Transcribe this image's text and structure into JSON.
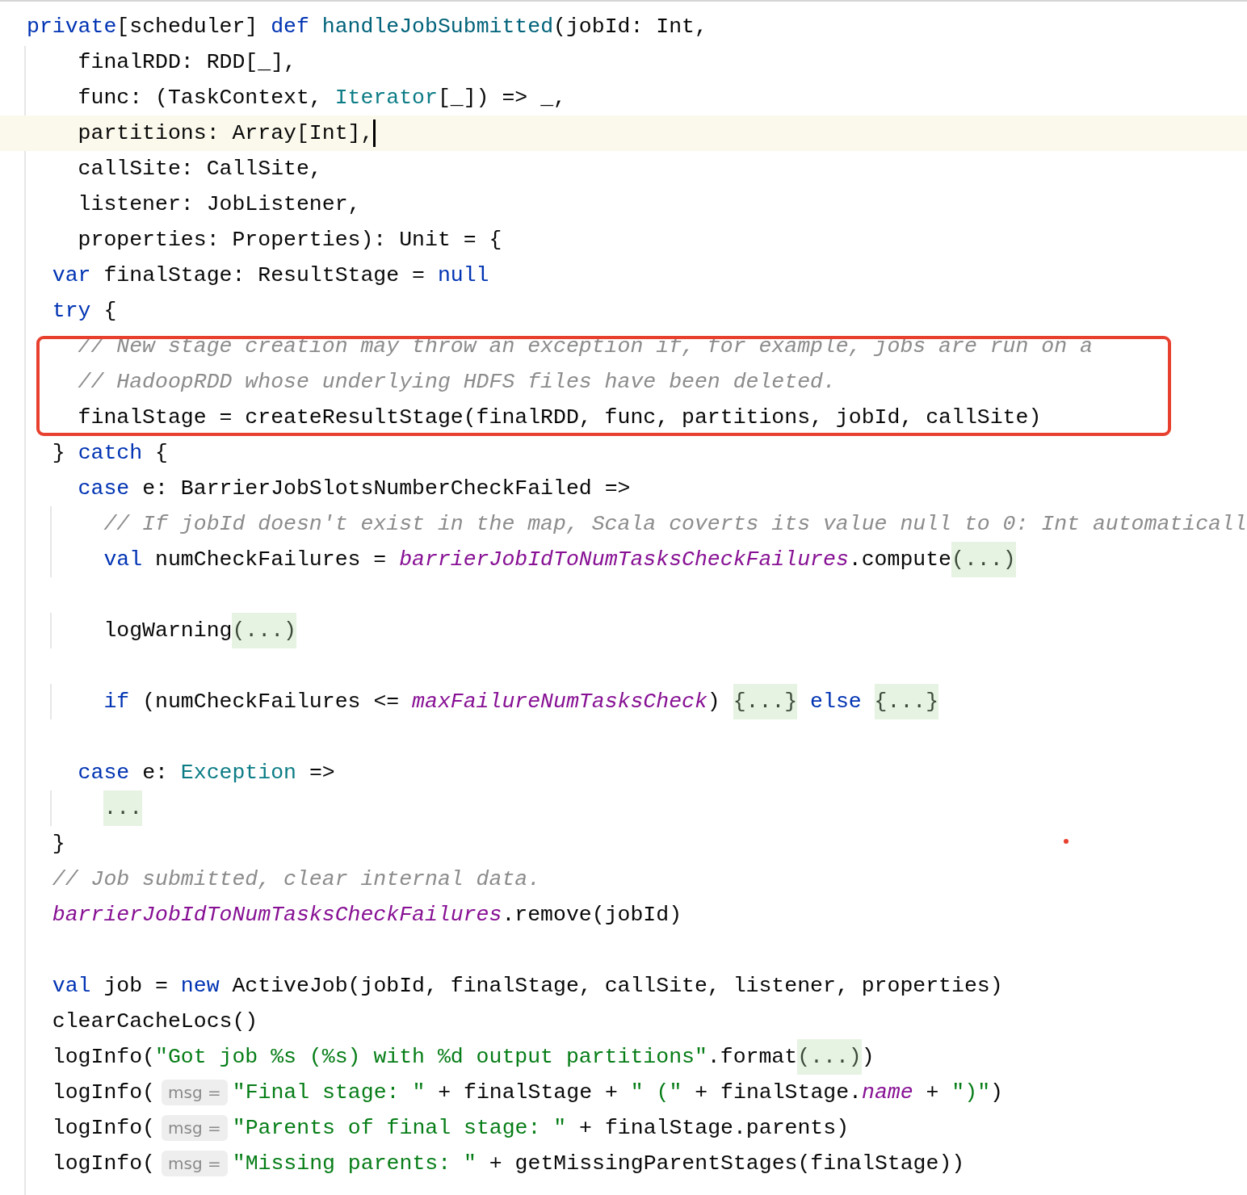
{
  "editor": {
    "blocks": [
      {
        "annotated": false,
        "lines": [
          {
            "current": false,
            "tokens": [
              {
                "kind": "kw",
                "text": "private"
              },
              {
                "kind": "plain",
                "text": "[scheduler] "
              },
              {
                "kind": "kw",
                "text": "def "
              },
              {
                "kind": "fn",
                "text": "handleJobSubmitted"
              },
              {
                "kind": "plain",
                "text": "(jobId: Int,"
              }
            ]
          },
          {
            "current": false,
            "tokens": [
              {
                "kind": "plain",
                "text": "    finalRDD: RDD[_],"
              }
            ]
          },
          {
            "current": false,
            "tokens": [
              {
                "kind": "plain",
                "text": "    func: (TaskContext, "
              },
              {
                "kind": "type",
                "text": "Iterator"
              },
              {
                "kind": "plain",
                "text": "[_]) => _,"
              }
            ]
          },
          {
            "current": true,
            "tokens": [
              {
                "kind": "plain",
                "text": "    partitions: Array[Int],"
              }
            ]
          },
          {
            "current": false,
            "tokens": [
              {
                "kind": "plain",
                "text": "    callSite: CallSite,"
              }
            ]
          },
          {
            "current": false,
            "tokens": [
              {
                "kind": "plain",
                "text": "    listener: JobListener,"
              }
            ]
          },
          {
            "current": false,
            "tokens": [
              {
                "kind": "plain",
                "text": "    properties: Properties): Unit = {"
              }
            ]
          },
          {
            "current": false,
            "tokens": [
              {
                "kind": "kw",
                "text": "  var"
              },
              {
                "kind": "plain",
                "text": " finalStage: ResultStage = "
              },
              {
                "kind": "kw",
                "text": "null"
              }
            ]
          },
          {
            "current": false,
            "tokens": [
              {
                "kind": "kw",
                "text": "  try"
              },
              {
                "kind": "plain",
                "text": " {"
              }
            ]
          }
        ]
      },
      {
        "annotated": true,
        "lines": [
          {
            "current": false,
            "tokens": [
              {
                "kind": "comment",
                "text": "    // New stage creation may throw an exception if, for example, jobs are run on a"
              }
            ]
          },
          {
            "current": false,
            "tokens": [
              {
                "kind": "comment",
                "text": "    // HadoopRDD whose underlying HDFS files have been deleted."
              }
            ]
          },
          {
            "current": false,
            "tokens": [
              {
                "kind": "plain",
                "text": "    finalStage = createResultStage(finalRDD, func, partitions, jobId, callSite)"
              }
            ]
          }
        ]
      },
      {
        "annotated": false,
        "lines": [
          {
            "current": false,
            "tokens": [
              {
                "kind": "plain",
                "text": "  } "
              },
              {
                "kind": "kw",
                "text": "catch"
              },
              {
                "kind": "plain",
                "text": " {"
              }
            ]
          },
          {
            "current": false,
            "tokens": [
              {
                "kind": "kw",
                "text": "    case"
              },
              {
                "kind": "plain",
                "text": " e: BarrierJobSlotsNumberCheckFailed =>"
              }
            ]
          },
          {
            "current": false,
            "tokens": [
              {
                "kind": "comment",
                "text": "      // If jobId doesn't exist in the map, Scala coverts its value null to 0: Int automaticall"
              }
            ]
          },
          {
            "current": false,
            "tokens": [
              {
                "kind": "kw",
                "text": "      val"
              },
              {
                "kind": "plain",
                "text": " numCheckFailures = "
              },
              {
                "kind": "field",
                "text": "barrierJobIdToNumTasksCheckFailures"
              },
              {
                "kind": "plain",
                "text": ".compute"
              },
              {
                "kind": "fold",
                "text": "(...)"
              }
            ]
          },
          {
            "current": false
          },
          {
            "current": false,
            "tokens": [
              {
                "kind": "plain",
                "text": "      logWarning"
              },
              {
                "kind": "fold",
                "text": "(...)"
              }
            ]
          },
          {
            "current": false
          },
          {
            "current": false,
            "tokens": [
              {
                "kind": "kw",
                "text": "      if"
              },
              {
                "kind": "plain",
                "text": " (numCheckFailures <= "
              },
              {
                "kind": "field",
                "text": "maxFailureNumTasksCheck"
              },
              {
                "kind": "plain",
                "text": ") "
              },
              {
                "kind": "fold",
                "text": "{...}"
              },
              {
                "kind": "kw",
                "text": " else "
              },
              {
                "kind": "fold",
                "text": "{...}"
              }
            ]
          },
          {
            "current": false
          },
          {
            "current": false,
            "tokens": [
              {
                "kind": "kw",
                "text": "    case"
              },
              {
                "kind": "plain",
                "text": " e: "
              },
              {
                "kind": "type",
                "text": "Exception"
              },
              {
                "kind": "plain",
                "text": " =>"
              }
            ]
          },
          {
            "current": false,
            "tokens": [
              {
                "kind": "fold",
                "text": "      ..."
              }
            ]
          },
          {
            "current": false,
            "tokens": [
              {
                "kind": "plain",
                "text": "  }"
              }
            ]
          },
          {
            "current": false,
            "tokens": [
              {
                "kind": "comment",
                "text": "  // Job submitted, clear internal data."
              }
            ]
          },
          {
            "current": false,
            "tokens": [
              {
                "kind": "field",
                "text": "  barrierJobIdToNumTasksCheckFailures"
              },
              {
                "kind": "plain",
                "text": ".remove(jobId)"
              }
            ]
          },
          {
            "current": false
          },
          {
            "current": false,
            "tokens": [
              {
                "kind": "kw",
                "text": "  val"
              },
              {
                "kind": "plain",
                "text": " job = "
              },
              {
                "kind": "kw",
                "text": "new"
              },
              {
                "kind": "plain",
                "text": " ActiveJob(jobId, finalStage, callSite, listener, properties)"
              }
            ]
          },
          {
            "current": false,
            "tokens": [
              {
                "kind": "plain",
                "text": "  clearCacheLocs()"
              }
            ]
          },
          {
            "current": false,
            "tokens": [
              {
                "kind": "plain",
                "text": "  logInfo("
              },
              {
                "kind": "string",
                "text": "\"Got job %s (%s) with %d output partitions\""
              },
              {
                "kind": "plain",
                "text": ".format"
              },
              {
                "kind": "fold",
                "text": "(...)"
              },
              {
                "kind": "plain",
                "text": ")"
              }
            ]
          },
          {
            "current": false,
            "tokens": [
              {
                "kind": "plain",
                "text": "  logInfo("
              },
              {
                "kind": "hint",
                "text": "msg ="
              },
              {
                "kind": "string",
                "text": "\"Final stage: \""
              },
              {
                "kind": "plain",
                "text": " + finalStage + "
              },
              {
                "kind": "string",
                "text": "\" (\""
              },
              {
                "kind": "plain",
                "text": " + finalStage."
              },
              {
                "kind": "field",
                "text": "name"
              },
              {
                "kind": "plain",
                "text": " + "
              },
              {
                "kind": "string",
                "text": "\")\""
              },
              {
                "kind": "plain",
                "text": ")"
              }
            ]
          },
          {
            "current": false,
            "tokens": [
              {
                "kind": "plain",
                "text": "  logInfo("
              },
              {
                "kind": "hint",
                "text": "msg ="
              },
              {
                "kind": "string",
                "text": "\"Parents of final stage: \""
              },
              {
                "kind": "plain",
                "text": " + finalStage.parents)"
              }
            ]
          },
          {
            "current": false,
            "tokens": [
              {
                "kind": "plain",
                "text": "  logInfo("
              },
              {
                "kind": "hint",
                "text": "msg ="
              },
              {
                "kind": "string",
                "text": "\"Missing parents: \""
              },
              {
                "kind": "plain",
                "text": " + getMissingParentStages(finalStage))"
              }
            ]
          }
        ]
      }
    ]
  }
}
